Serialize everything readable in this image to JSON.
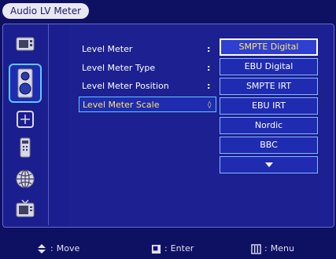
{
  "window": {
    "title": "Audio LV Meter"
  },
  "sidebar": {
    "items": [
      {
        "icon": "display-icon",
        "active": false
      },
      {
        "icon": "speaker-icon",
        "active": true
      },
      {
        "icon": "crosshair-icon",
        "active": false
      },
      {
        "icon": "remote-icon",
        "active": false
      },
      {
        "icon": "globe-icon",
        "active": false
      },
      {
        "icon": "tv-icon",
        "active": false
      }
    ]
  },
  "menu": {
    "rows": [
      {
        "label": "Level Meter",
        "sep": ":"
      },
      {
        "label": "Level Meter Type",
        "sep": ":"
      },
      {
        "label": "Level Meter Position",
        "sep": ":"
      },
      {
        "label": "Level Meter Scale",
        "sep": "◊"
      }
    ]
  },
  "dropdown": {
    "options": [
      "SMPTE Digital",
      "EBU Digital",
      "SMPTE IRT",
      "EBU IRT",
      "Nordic",
      "BBC"
    ],
    "selected": "SMPTE Digital",
    "more_icon": "arrow-down-icon"
  },
  "footer": {
    "move": "Move",
    "enter": "Enter",
    "menu": "Menu",
    "sep": ":"
  },
  "colors": {
    "background": "#0e1062",
    "panel": "#1c2090",
    "highlight": "#ffe46a",
    "border": "#5ec8ff"
  }
}
